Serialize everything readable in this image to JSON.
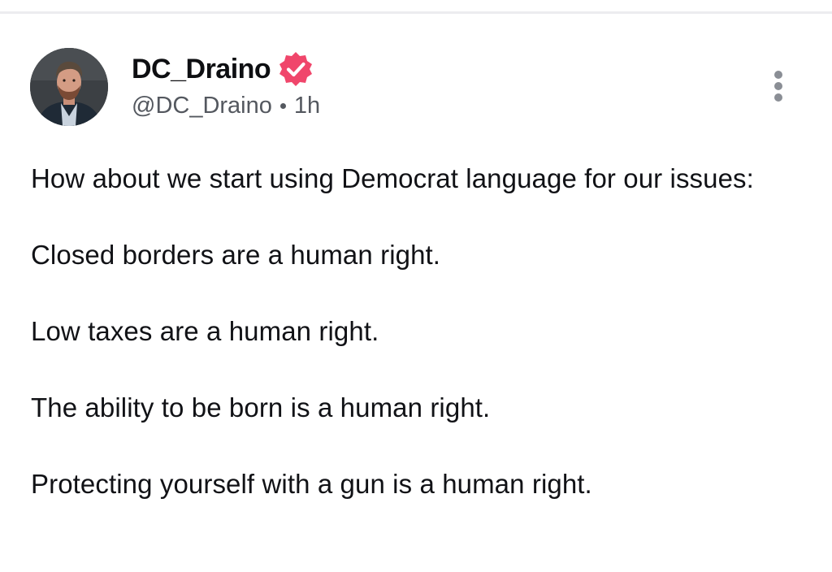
{
  "post": {
    "author": {
      "display_name": "DC_Draino",
      "handle": "@DC_Draino",
      "verified": true,
      "verified_badge_color": "#f0466b"
    },
    "timestamp": "1h",
    "menu_icon": "more-vertical-icon",
    "paragraphs": [
      "How about we start using Democrat language for our issues:",
      "Closed borders are a human right.",
      "Low taxes are a human right.",
      "The ability to be born is a human right.",
      "Protecting yourself with a gun is a human right."
    ]
  }
}
